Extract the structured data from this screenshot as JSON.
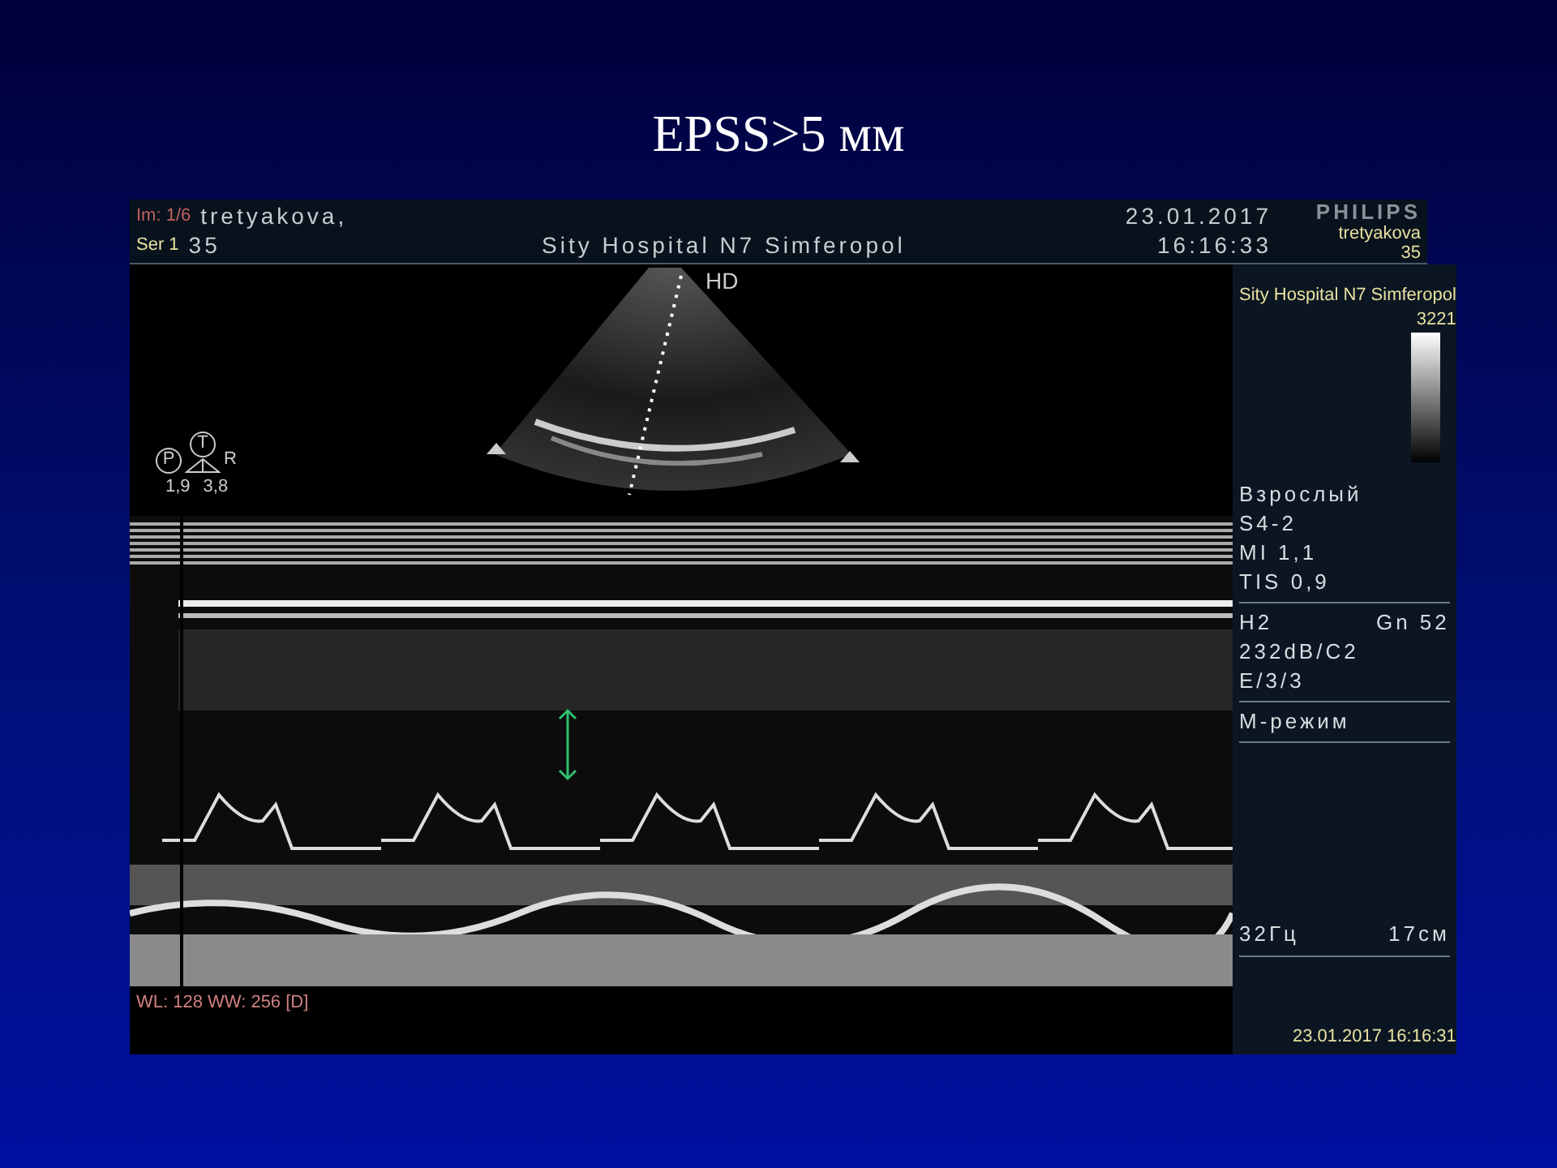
{
  "slide": {
    "title": "EPSS>5 мм"
  },
  "header": {
    "patient": "tretyakova,",
    "age": "35",
    "hospital": "Sity Hospital N7 Simferopol",
    "date": "23.01.2017",
    "time": "16:16:33",
    "brand": "PHILIPS"
  },
  "overlay": {
    "image_number": "Im: 1/6",
    "series": "Ser 1",
    "patient": "tretyakova",
    "age": "35",
    "hospital": "Sity Hospital N7 Simferopol",
    "id": "3221",
    "window": "WL: 128 WW: 256 [D]",
    "timestamp": "23.01.2017 16:16:31"
  },
  "sector": {
    "label": "HD"
  },
  "orientation": {
    "p": "P",
    "t": "T",
    "r": "R",
    "left_value": "1,9",
    "right_value": "3,8"
  },
  "side_panel": {
    "groups": [
      {
        "lines": [
          [
            "Взрослый"
          ],
          [
            "S4-2"
          ],
          [
            "MI 1,1"
          ],
          [
            "TIS 0,9"
          ]
        ]
      },
      {
        "lines": [
          [
            "H2",
            "Gn 52"
          ],
          [
            "232dB/C2"
          ],
          [
            "E/3/3"
          ]
        ]
      },
      {
        "lines": [
          [
            "M-режим"
          ]
        ]
      }
    ],
    "bottom": [
      "32Гц",
      "17см"
    ]
  }
}
